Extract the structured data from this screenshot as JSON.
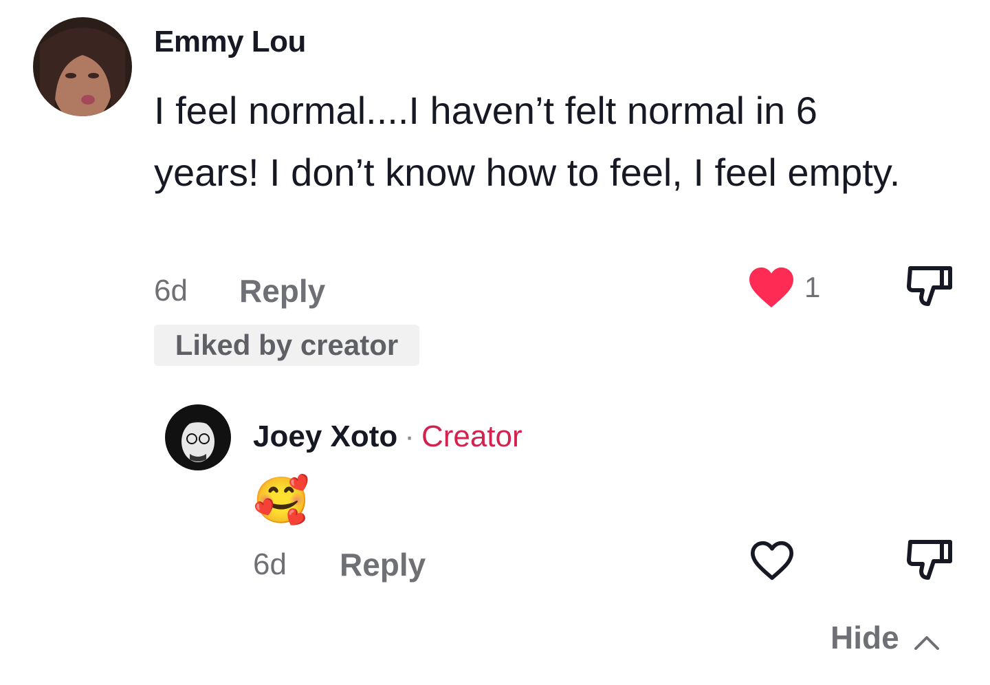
{
  "comments": [
    {
      "author": "Emmy Lou",
      "text": "I feel normal....I haven’t felt normal in 6 years! I don’t know how to feel, I feel empty.",
      "time": "6d",
      "reply_label": "Reply",
      "like_count": "1",
      "liked": true,
      "liked_by_creator_label": "Liked by creator"
    }
  ],
  "reply": {
    "author": "Joey Xoto",
    "separator": "·",
    "badge": "Creator",
    "text": "🥰",
    "time": "6d",
    "reply_label": "Reply",
    "liked": false
  },
  "hide_label": "Hide",
  "colors": {
    "like_red": "#fe2c55",
    "creator_pink": "#d3224f",
    "muted": "#6f7076"
  }
}
